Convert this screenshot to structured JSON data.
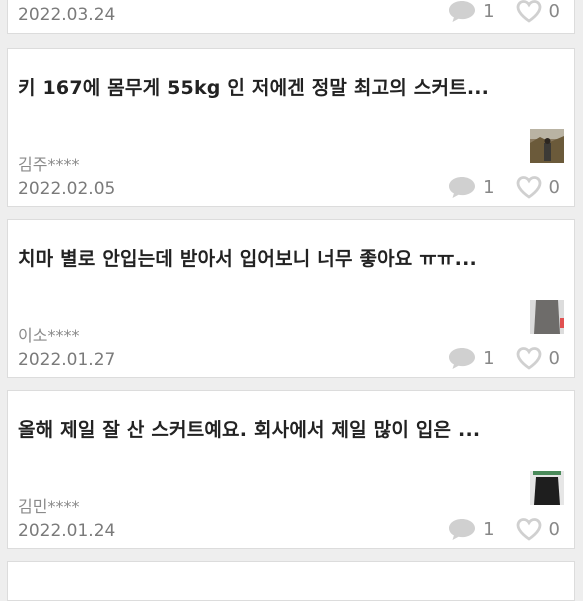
{
  "reviews": [
    {
      "title": "",
      "author": "",
      "date": "2022.03.24",
      "comments": "1",
      "likes": "0"
    },
    {
      "title": "키 167에 몸무게 55kg 인 저에겐 정말 최고의 스커트...",
      "author": "김주****",
      "date": "2022.02.05",
      "comments": "1",
      "likes": "0"
    },
    {
      "title": "치마 별로 안입는데 받아서 입어보니 너무 좋아요 ㅠㅠ...",
      "author": "이소****",
      "date": "2022.01.27",
      "comments": "1",
      "likes": "0"
    },
    {
      "title": "올해 제일 잘 산 스커트예요. 회사에서 제일 많이 입은 ...",
      "author": "김민****",
      "date": "2022.01.24",
      "comments": "1",
      "likes": "0"
    }
  ],
  "icons": {
    "comment": "speech-bubble-icon",
    "like": "heart-outline-icon"
  },
  "colors": {
    "icon": "#d0d0d0",
    "count": "#888888",
    "date": "#7a7a7a",
    "author": "#8a8a8a"
  }
}
